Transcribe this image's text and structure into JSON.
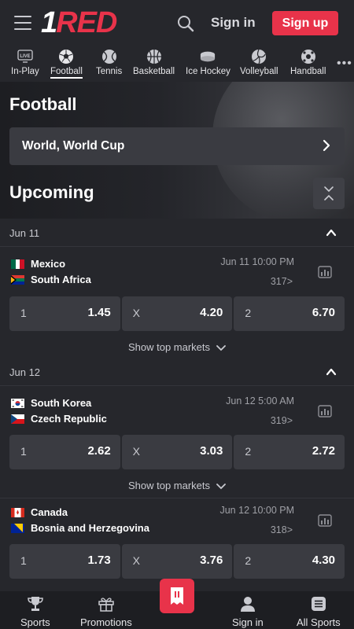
{
  "header": {
    "logo_one": "1",
    "logo_red": "RED",
    "signin_label": "Sign in",
    "signup_label": "Sign up"
  },
  "sports_tabs": [
    {
      "label": "In-Play",
      "icon": "live-icon",
      "badge": "LIVE"
    },
    {
      "label": "Football",
      "icon": "football-icon",
      "active": true
    },
    {
      "label": "Tennis",
      "icon": "tennis-icon"
    },
    {
      "label": "Basketball",
      "icon": "basketball-icon"
    },
    {
      "label": "Ice Hockey",
      "icon": "ice-hockey-icon"
    },
    {
      "label": "Volleyball",
      "icon": "volleyball-icon"
    },
    {
      "label": "Handball",
      "icon": "handball-icon"
    }
  ],
  "hero": {
    "title": "Football",
    "league": "World, World Cup",
    "section_title": "Upcoming"
  },
  "groups": [
    {
      "date": "Jun 11",
      "matches": [
        {
          "home": "Mexico",
          "away": "South Africa",
          "time": "Jun 11 10:00 PM",
          "markets": "317",
          "odds": [
            {
              "label": "1",
              "value": "1.45"
            },
            {
              "label": "X",
              "value": "4.20"
            },
            {
              "label": "2",
              "value": "6.70"
            }
          ],
          "show_more": "Show top markets"
        }
      ]
    },
    {
      "date": "Jun 12",
      "matches": [
        {
          "home": "South Korea",
          "away": "Czech Republic",
          "time": "Jun 12 5:00 AM",
          "markets": "319",
          "odds": [
            {
              "label": "1",
              "value": "2.62"
            },
            {
              "label": "X",
              "value": "3.03"
            },
            {
              "label": "2",
              "value": "2.72"
            }
          ],
          "show_more": "Show top markets"
        },
        {
          "home": "Canada",
          "away": "Bosnia and Herzegovina",
          "time": "Jun 12 10:00 PM",
          "markets": "318",
          "odds": [
            {
              "label": "1",
              "value": "1.73"
            },
            {
              "label": "X",
              "value": "3.76"
            },
            {
              "label": "2",
              "value": "4.30"
            }
          ]
        }
      ]
    }
  ],
  "bottom_nav": [
    {
      "label": "Sports",
      "icon": "trophy-icon"
    },
    {
      "label": "Promotions",
      "icon": "gift-icon"
    },
    {
      "label": "Sign in",
      "icon": "user-icon"
    },
    {
      "label": "All Sports",
      "icon": "list-icon"
    }
  ],
  "colors": {
    "accent": "#e8334a",
    "background": "#26272c",
    "card": "#3a3b41"
  }
}
